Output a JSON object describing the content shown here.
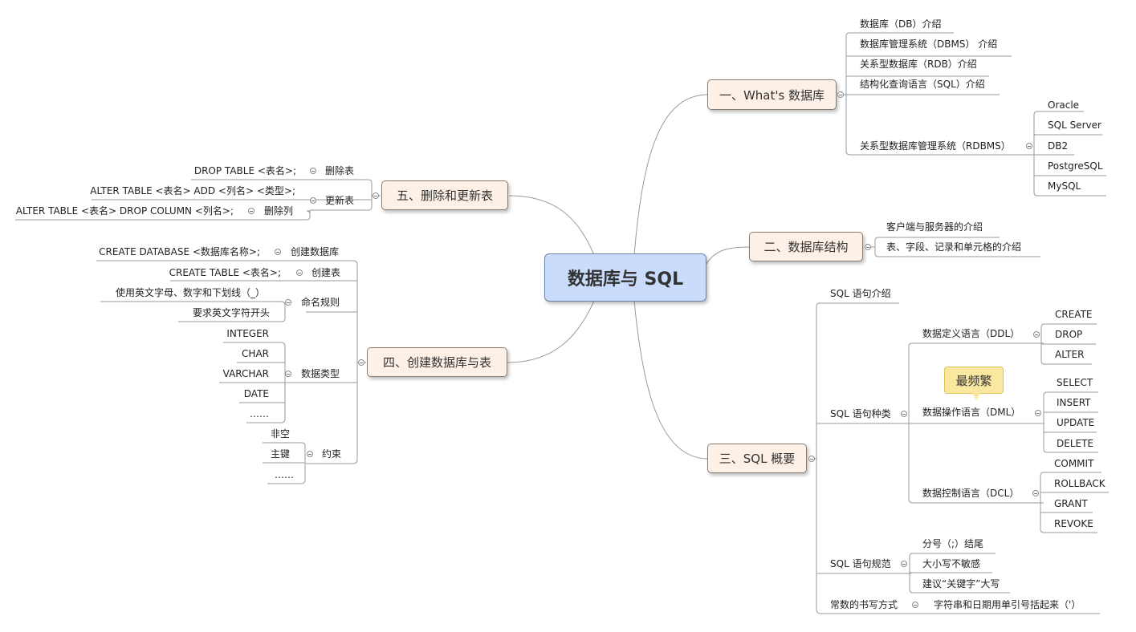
{
  "root": {
    "title": "数据库与 SQL"
  },
  "branch1": {
    "title": "一、What's 数据库",
    "items": [
      "数据库（DB）介绍",
      "数据库管理系统（DBMS） 介绍",
      "关系型数据库（RDB）介绍",
      "结构化查询语言（SQL）介绍",
      "关系型数据库管理系统（RDBMS）"
    ],
    "rdbms": [
      "Oracle",
      "SQL Server",
      "DB2",
      "PostgreSQL",
      "MySQL"
    ]
  },
  "branch2": {
    "title": "二、数据库结构",
    "items": [
      "客户端与服务器的介绍",
      "表、字段、记录和单元格的介绍"
    ]
  },
  "branch3": {
    "title": "三、SQL 概要",
    "intro": "SQL 语句介绍",
    "kinds": "SQL 语句种类",
    "ddl": {
      "label": "数据定义语言（DDL）",
      "items": [
        "CREATE",
        "DROP",
        "ALTER"
      ]
    },
    "dml": {
      "label": "数据操作语言（DML）",
      "items": [
        "SELECT",
        "INSERT",
        "UPDATE",
        "DELETE"
      ],
      "callout": "最频繁"
    },
    "dcl": {
      "label": "数据控制语言（DCL）",
      "items": [
        "COMMIT",
        "ROLLBACK",
        "GRANT",
        "REVOKE"
      ]
    },
    "rules": {
      "label": "SQL 语句规范",
      "items": [
        "分号（;）结尾",
        "大小写不敏感",
        "建议“关键字”大写"
      ]
    },
    "constants": {
      "label": "常数的书写方式",
      "item": "字符串和日期用单引号括起来（'）"
    }
  },
  "branch4": {
    "title": "四、创建数据库与表",
    "createdb": {
      "label": "创建数据库",
      "item": "CREATE DATABASE <数据库名称>;"
    },
    "createtable": {
      "label": "创建表",
      "item": "CREATE TABLE <表名>;"
    },
    "naming": {
      "label": "命名规则",
      "items": [
        "使用英文字母、数字和下划线（_）",
        "要求英文字符开头"
      ]
    },
    "types": {
      "label": "数据类型",
      "items": [
        "INTEGER",
        "CHAR",
        "VARCHAR",
        "DATE",
        "……"
      ]
    },
    "constraints": {
      "label": "约束",
      "items": [
        "非空",
        "主键",
        "……"
      ]
    }
  },
  "branch5": {
    "title": "五、删除和更新表",
    "drop": {
      "label": "删除表",
      "item": "DROP TABLE <表名>;"
    },
    "update": {
      "label": "更新表",
      "items": [
        "ALTER TABLE <表名>  ADD <列名> <类型>;"
      ]
    },
    "dropcol": {
      "label": "删除列",
      "item": "ALTER TABLE <表名>  DROP  COLUMN  <列名>;"
    }
  }
}
